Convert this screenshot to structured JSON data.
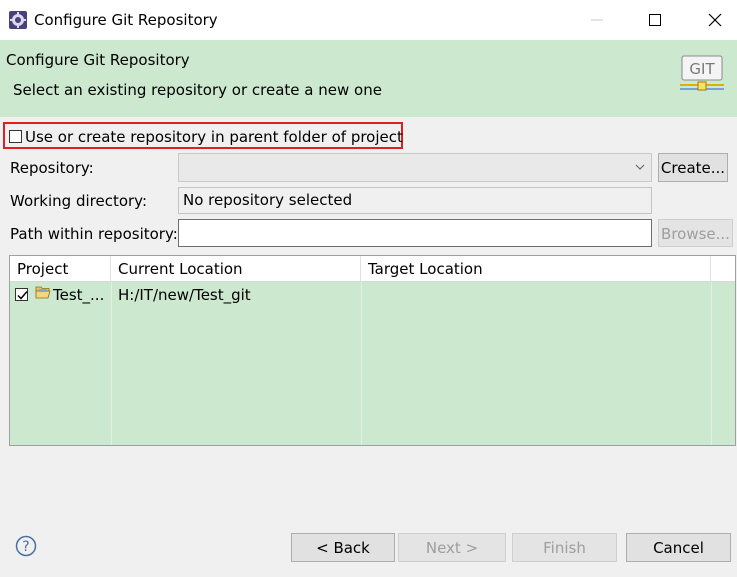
{
  "window": {
    "title": "Configure Git Repository",
    "icon": "eclipse-gear-icon",
    "controls": [
      "minimize-icon",
      "maximize-icon",
      "close-icon"
    ]
  },
  "banner": {
    "title": "Configure Git Repository",
    "subtitle": "Select an existing repository or create a new one",
    "logo_text": "GIT"
  },
  "parent_option": {
    "label": "Use or create repository in parent folder of project",
    "checked": false
  },
  "form": {
    "repository_label": "Repository:",
    "repository_value": "",
    "create_button": "Create...",
    "working_dir_label": "Working directory:",
    "working_dir_value": "No repository selected",
    "path_label": "Path within repository:",
    "path_value": "",
    "browse_button": "Browse..."
  },
  "table": {
    "columns": [
      "Project",
      "Current Location",
      "Target Location"
    ],
    "rows": [
      {
        "checked": true,
        "project": "Test_...",
        "current_location": "H:/IT/new/Test_git",
        "target_location": ""
      }
    ]
  },
  "footer": {
    "back_button": "< Back",
    "next_button": "Next >",
    "finish_button": "Finish",
    "cancel_button": "Cancel"
  },
  "colors": {
    "banner_bg": "#cce8cf",
    "highlight_border": "#e02020",
    "help_icon": "#4a6fa5"
  }
}
